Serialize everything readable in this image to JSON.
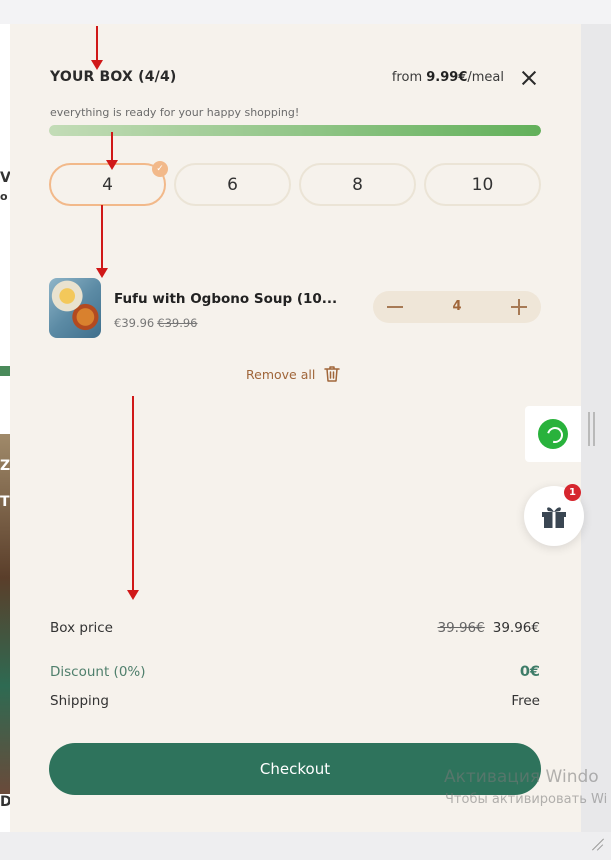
{
  "cart": {
    "title": "YOUR BOX (4/4)",
    "price_prefix": "from ",
    "price_value": "9.99€",
    "price_suffix": "/meal",
    "ready_text": "everything is ready for your happy shopping!",
    "progress": 1.0,
    "sizes": [
      {
        "label": "4",
        "selected": true
      },
      {
        "label": "6",
        "selected": false
      },
      {
        "label": "8",
        "selected": false
      },
      {
        "label": "10",
        "selected": false
      }
    ],
    "size_check_glyph": "✓",
    "item": {
      "name": "Fufu with Ogbono Soup (10...",
      "price": "€39.96",
      "old_price": "€39.96",
      "quantity": "4",
      "image_icon": "meal-photo"
    },
    "remove_all": "Remove all",
    "summary": {
      "box_price_label": "Box price",
      "box_price_old": "39.96€",
      "box_price": "39.96€",
      "discount_label": "Discount (0%)",
      "discount_value": "0€",
      "shipping_label": "Shipping",
      "shipping_value": "Free"
    },
    "checkout_label": "Checkout"
  },
  "widgets": {
    "whatsapp_icon": "whatsapp-icon",
    "gift_icon": "gift-icon",
    "gift_badge": "1"
  },
  "background_page": {
    "glyphs": [
      "V",
      "o",
      "Z",
      "T",
      "D"
    ]
  },
  "watermark": {
    "line1": "Активация Windo",
    "line2": "Чтобы активировать Wi"
  },
  "colors": {
    "panel_bg": "#f6f2ec",
    "accent_green": "#2e735c",
    "accent_brown": "#a0663a",
    "selected_border": "#f2b98a",
    "annotation_red": "#d01818"
  }
}
